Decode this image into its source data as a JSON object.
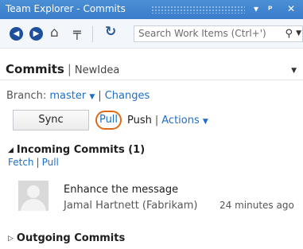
{
  "window": {
    "title": "Team Explorer - Commits",
    "dropdown_icon": "▾",
    "pin_icon": "ᵖ",
    "close_icon": "✕"
  },
  "toolbar": {
    "back_icon": "back-arrow",
    "forward_icon": "forward-arrow",
    "home_icon": "home",
    "pin_icon": "pin",
    "refresh_icon": "refresh",
    "search_placeholder": "Search Work Items (Ctrl+')"
  },
  "header": {
    "title": "Commits",
    "subtitle": "NewIdea"
  },
  "branch": {
    "label": "Branch:",
    "value": "master",
    "changes_link": "Changes"
  },
  "sync_row": {
    "sync_label": "Sync",
    "pull_label": "Pull",
    "push_label": "Push",
    "actions_label": "Actions"
  },
  "incoming": {
    "title": "Incoming Commits (1)",
    "fetch_label": "Fetch",
    "pull_label": "Pull",
    "commits": [
      {
        "message": "Enhance the message",
        "author": "Jamal Hartnett (Fabrikam)",
        "time": "24 minutes ago"
      }
    ]
  },
  "outgoing": {
    "title": "Outgoing Commits"
  },
  "colors": {
    "titlebar": "#3a7cc9",
    "link": "#1e6fc9",
    "highlight": "#e06a12"
  }
}
